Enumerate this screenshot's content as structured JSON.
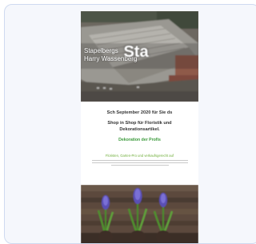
{
  "newsletter": {
    "hero": {
      "logo_line1": "Stapelbergs",
      "logo_line2": "Harry Wassenberg",
      "badge": "Sta"
    },
    "date_line": "Sch September 2020 für Sie ds",
    "headline": "Shop in Shop für Floristik und Dekorationsartikel.",
    "cta": "Dekoration der Profis",
    "subheading": "Floristen, Garten-Pro und verkaufsgerecht auf",
    "colors": {
      "cta_green": "#3c9a3c",
      "subheading_green": "#6fae3a",
      "card_border": "#cfdaf0",
      "card_background": "#f5f7fc"
    },
    "photo_icon": "hyacinth-bulbs-image"
  }
}
